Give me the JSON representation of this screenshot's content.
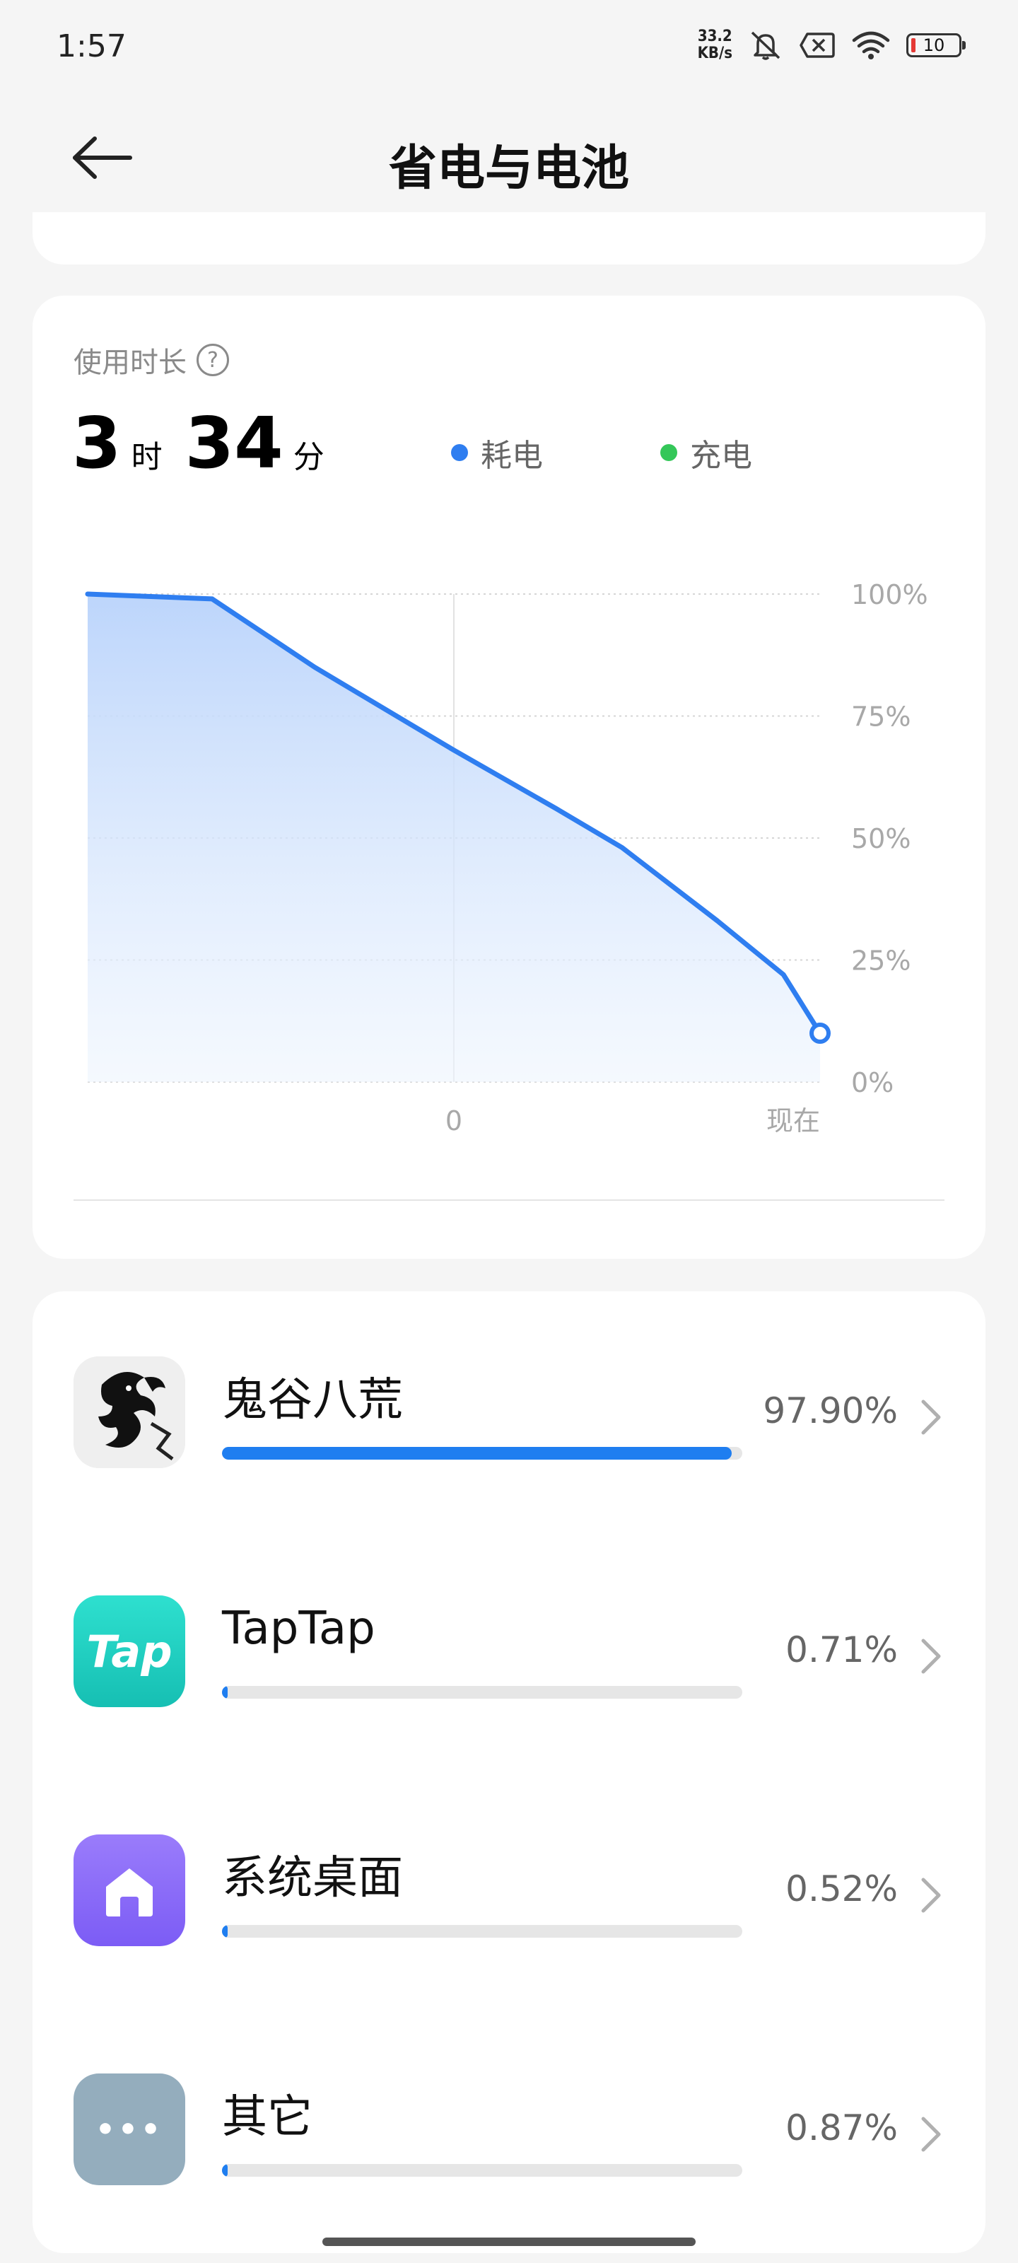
{
  "status_bar": {
    "time": "1:57",
    "net_speed_value": "33.2",
    "net_speed_unit": "KB/s",
    "battery_level": "10"
  },
  "header": {
    "title": "省电与电池"
  },
  "usage": {
    "label": "使用时长",
    "hours": "3",
    "hours_unit": "时",
    "minutes": "34",
    "minutes_unit": "分",
    "legend": [
      {
        "label": "耗电",
        "color": "#2f7ef0"
      },
      {
        "label": "充电",
        "color": "#34c759"
      }
    ]
  },
  "chart_data": {
    "type": "area",
    "y_ticks": [
      "100%",
      "75%",
      "50%",
      "25%",
      "0%"
    ],
    "x_ticks": [
      "0",
      "现在"
    ],
    "ylim": [
      0,
      100
    ],
    "series": [
      {
        "name": "耗电",
        "color": "#2f7ef0",
        "points": [
          [
            0,
            100
          ],
          [
            0.17,
            99
          ],
          [
            0.31,
            85
          ],
          [
            0.5,
            68
          ],
          [
            0.64,
            56
          ],
          [
            0.73,
            48
          ],
          [
            0.86,
            33
          ],
          [
            0.95,
            22
          ],
          [
            1.0,
            10
          ]
        ]
      }
    ]
  },
  "apps": [
    {
      "name": "鬼谷八荒",
      "percent": "97.90%",
      "fraction": 0.979,
      "icon": "dragon-icon"
    },
    {
      "name": "TapTap",
      "percent": "0.71%",
      "fraction": 0.0071,
      "icon": "taptap-icon",
      "icon_text": "Tap"
    },
    {
      "name": "系统桌面",
      "percent": "0.52%",
      "fraction": 0.0052,
      "icon": "home-icon"
    },
    {
      "name": "其它",
      "percent": "0.87%",
      "fraction": 0.0087,
      "icon": "more-icon",
      "icon_text": "•••"
    }
  ]
}
